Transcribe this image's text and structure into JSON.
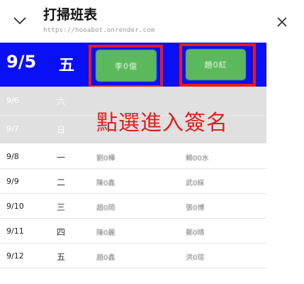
{
  "header": {
    "title": "打掃班表",
    "url": "https://hooabot.onrender.com",
    "collapse_icon": "chevron-down-icon",
    "close_icon": "close-icon"
  },
  "active_row": {
    "date": "9/5",
    "weekday": "五",
    "name1": "李0億",
    "name2": "趙0紅"
  },
  "gray_rows": [
    {
      "date": "9/6",
      "weekday": "六"
    },
    {
      "date": "9/7",
      "weekday": "日"
    }
  ],
  "annotation": "點選進入簽名",
  "rows": [
    {
      "date": "9/8",
      "weekday": "一",
      "name1": "劉0樺",
      "name2": "賴00水"
    },
    {
      "date": "9/9",
      "weekday": "二",
      "name1": "陳0鑫",
      "name2": "武0綵"
    },
    {
      "date": "9/10",
      "weekday": "三",
      "name1": "趙0岡",
      "name2": "張0博"
    },
    {
      "date": "9/11",
      "weekday": "四",
      "name1": "陳0麗",
      "name2": "鄭0晴"
    },
    {
      "date": "9/12",
      "weekday": "五",
      "name1": "趙0鑫",
      "name2": "洪0瑄"
    }
  ],
  "colors": {
    "active_bg": "#0a10f5",
    "button_green": "#5cb85c",
    "highlight_red": "#e51c1c",
    "inactive_gray": "#e0e0e0"
  }
}
